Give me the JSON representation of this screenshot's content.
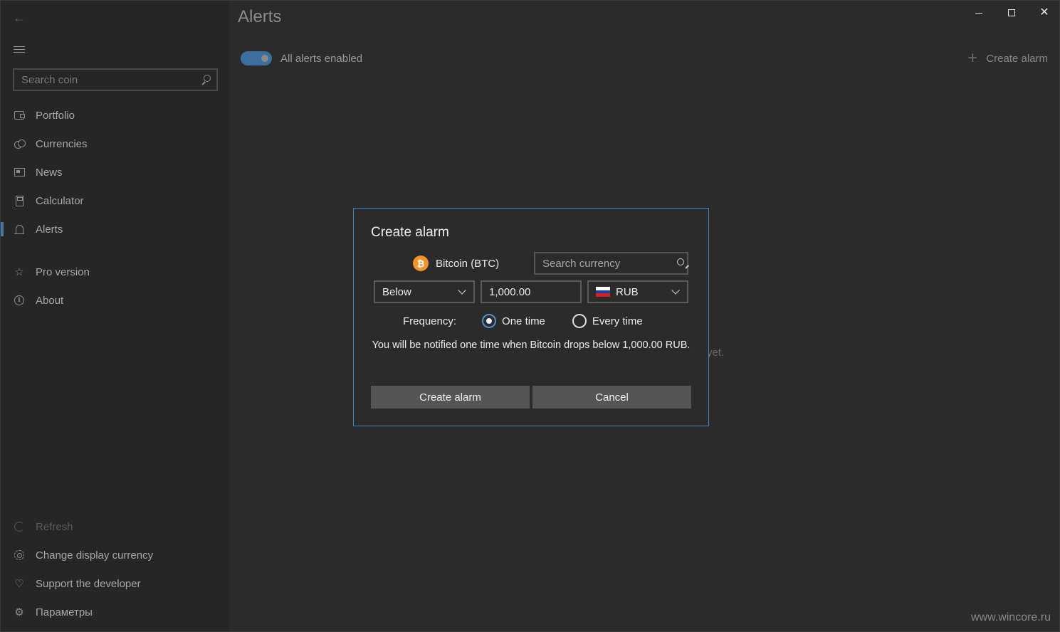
{
  "sidebar": {
    "search_placeholder": "Search coin",
    "items": [
      {
        "label": "Portfolio",
        "icon": "wallet-icon"
      },
      {
        "label": "Currencies",
        "icon": "coins-icon"
      },
      {
        "label": "News",
        "icon": "news-icon"
      },
      {
        "label": "Calculator",
        "icon": "calculator-icon"
      },
      {
        "label": "Alerts",
        "icon": "bell-icon",
        "active": true
      }
    ],
    "secondary": [
      {
        "label": "Pro version",
        "icon": "star-icon"
      },
      {
        "label": "About",
        "icon": "info-icon"
      }
    ],
    "bottom": [
      {
        "label": "Refresh",
        "icon": "refresh-icon",
        "disabled": true
      },
      {
        "label": "Change display currency",
        "icon": "currency-icon"
      },
      {
        "label": "Support the developer",
        "icon": "heart-icon"
      },
      {
        "label": "Параметры",
        "icon": "gear-icon"
      }
    ]
  },
  "header": {
    "title": "Alerts",
    "toggle_label": "All alerts enabled",
    "toggle_on": true,
    "create_label": "Create alarm"
  },
  "main": {
    "empty_fragment": "yet."
  },
  "dialog": {
    "title": "Create alarm",
    "coin": "Bitcoin (BTC)",
    "search_placeholder": "Search currency",
    "condition": "Below",
    "amount": "1,000.00",
    "currency": "RUB",
    "frequency_label": "Frequency:",
    "options": [
      "One time",
      "Every time"
    ],
    "selected_option": "One time",
    "notice": "You will be notified one time when Bitcoin drops below 1,000.00 RUB.",
    "ok_label": "Create alarm",
    "cancel_label": "Cancel"
  },
  "watermark": "www.wincore.ru",
  "colors": {
    "accent": "#3e88c8",
    "toggle": "#3d6f9e",
    "bitcoin": "#f2922c"
  }
}
